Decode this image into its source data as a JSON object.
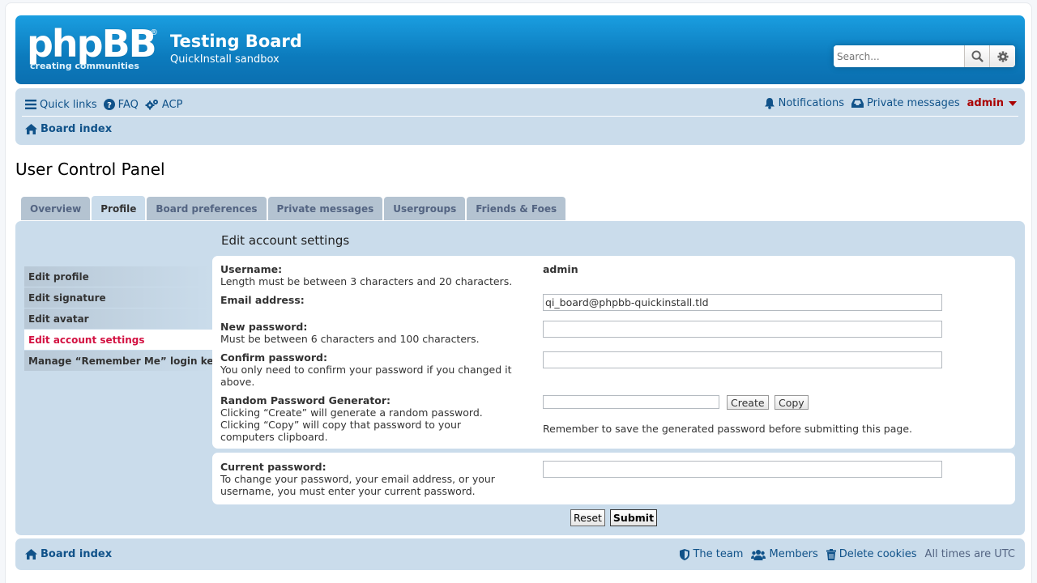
{
  "header": {
    "logo_text": "phpBB",
    "logo_tagline": "creating communities",
    "site_title": "Testing Board",
    "site_description": "QuickInstall sandbox",
    "search_placeholder": "Search..."
  },
  "nav": {
    "quick_links": "Quick links",
    "faq": "FAQ",
    "acp": "ACP",
    "notifications": "Notifications",
    "private_messages": "Private messages",
    "username": "admin",
    "board_index": "Board index"
  },
  "page_title": "User Control Panel",
  "tabs": [
    {
      "label": "Overview",
      "active": false
    },
    {
      "label": "Profile",
      "active": true
    },
    {
      "label": "Board preferences",
      "active": false
    },
    {
      "label": "Private messages",
      "active": false
    },
    {
      "label": "Usergroups",
      "active": false
    },
    {
      "label": "Friends & Foes",
      "active": false
    }
  ],
  "sidebar": {
    "items": [
      {
        "label": "Edit profile",
        "active": false
      },
      {
        "label": "Edit signature",
        "active": false
      },
      {
        "label": "Edit avatar",
        "active": false
      },
      {
        "label": "Edit account settings",
        "active": true
      },
      {
        "label": "Manage “Remember Me” login keys",
        "active": false
      }
    ]
  },
  "form": {
    "heading": "Edit account settings",
    "username_label": "Username:",
    "username_hint": "Length must be between 3 characters and 20 characters.",
    "username_value": "admin",
    "email_label": "Email address:",
    "email_value": "qi_board@phpbb-quickinstall.tld",
    "new_password_label": "New password:",
    "new_password_hint": "Must be between 6 characters and 100 characters.",
    "confirm_password_label": "Confirm password:",
    "confirm_password_hint": "You only need to confirm your password if you changed it above.",
    "generator_label": "Random Password Generator:",
    "generator_hint1": "Clicking “Create” will generate a random password.",
    "generator_hint2": "Clicking “Copy” will copy that password to your computers clipboard.",
    "create_button": "Create",
    "copy_button": "Copy",
    "generator_note": "Remember to save the generated password before submitting this page.",
    "current_password_label": "Current password:",
    "current_password_hint": "To change your password, your email address, or your username, you must enter your current password.",
    "reset_button": "Reset",
    "submit_button": "Submit"
  },
  "footer": {
    "board_index": "Board index",
    "the_team": "The team",
    "members": "Members",
    "delete_cookies": "Delete cookies",
    "timezone": "All times are UTC"
  },
  "colors": {
    "header_blue": "#0c7bbd",
    "nav_bg": "#cadceb",
    "link": "#105289",
    "active_red": "#d31141",
    "user_red": "#aa0000"
  }
}
